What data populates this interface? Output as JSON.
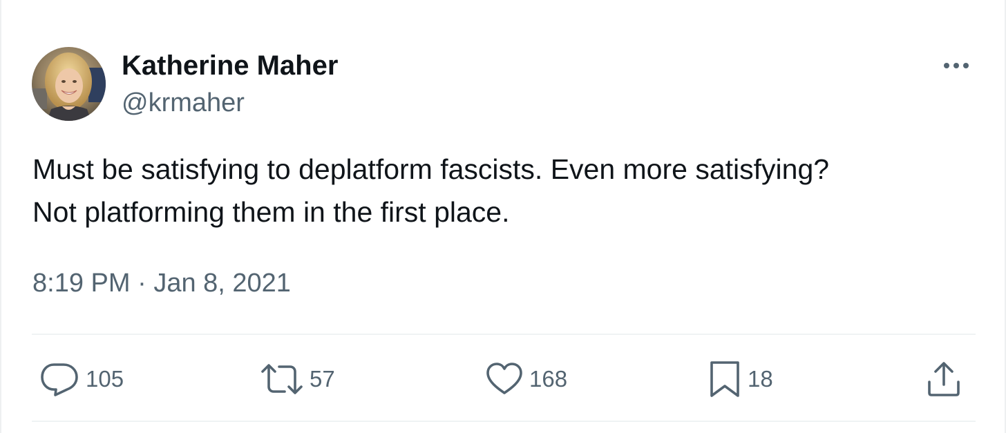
{
  "author": {
    "display_name": "Katherine Maher",
    "handle": "@krmaher"
  },
  "tweet": {
    "text_line1": "Must be satisfying to deplatform fascists. Even more satisfying?",
    "text_line2": "Not platforming them in the first place.",
    "time": "8:19 PM",
    "separator": "·",
    "date": "Jan 8, 2021"
  },
  "actions": {
    "replies": "105",
    "retweets": "57",
    "likes": "168",
    "bookmarks": "18"
  },
  "icons": {
    "more": "more-horizontal-icon",
    "reply": "reply-icon",
    "retweet": "retweet-icon",
    "like": "heart-icon",
    "bookmark": "bookmark-icon",
    "share": "share-icon"
  },
  "colors": {
    "text_primary": "#0f1419",
    "text_secondary": "#536471",
    "divider": "#eff3f4"
  }
}
